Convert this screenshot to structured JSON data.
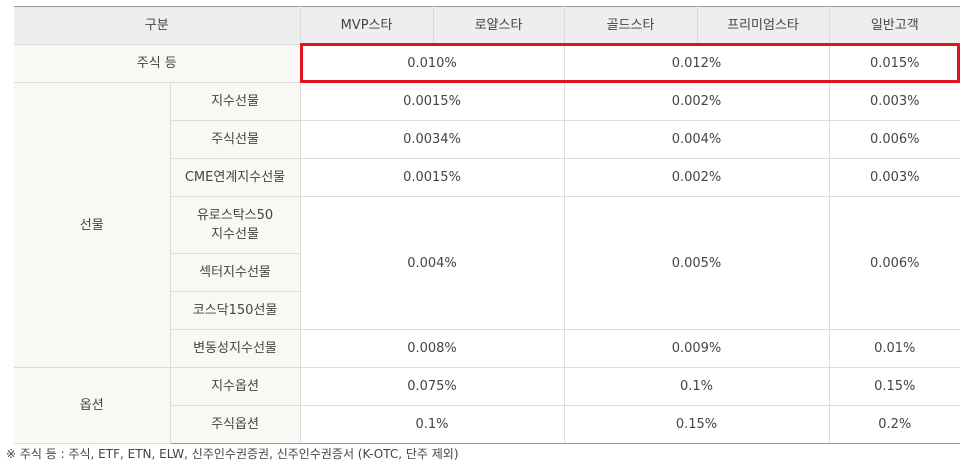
{
  "header": {
    "category": "구분",
    "tiers": [
      "MVP스타",
      "로얄스타",
      "골드스타",
      "프리미엄스타",
      "일반고객"
    ]
  },
  "stock": {
    "label": "주식 등",
    "values": [
      "0.010%",
      "0.012%",
      "0.015%"
    ]
  },
  "futures": {
    "group_label": "선물",
    "rows": [
      {
        "label": "지수선물",
        "values": [
          "0.0015%",
          "0.002%",
          "0.003%"
        ]
      },
      {
        "label": "주식선물",
        "values": [
          "0.0034%",
          "0.004%",
          "0.006%"
        ]
      },
      {
        "label": "CME연계지수선물",
        "values": [
          "0.0015%",
          "0.002%",
          "0.003%"
        ]
      },
      {
        "label_line1": "유로스탁스50",
        "label_line2": "지수선물"
      },
      {
        "label": "섹터지수선물"
      },
      {
        "label": "코스닥150선물"
      },
      {
        "label": "변동성지수선물",
        "values": [
          "0.008%",
          "0.009%",
          "0.01%"
        ]
      }
    ],
    "merged_values": [
      "0.004%",
      "0.005%",
      "0.006%"
    ]
  },
  "options": {
    "group_label": "옵션",
    "rows": [
      {
        "label": "지수옵션",
        "values": [
          "0.075%",
          "0.1%",
          "0.15%"
        ]
      },
      {
        "label": "주식옵션",
        "values": [
          "0.1%",
          "0.15%",
          "0.2%"
        ]
      }
    ]
  },
  "footnote": "※ 주식 등 : 주식, ETF, ETN, ELW, 신주인수권증권, 신주인수권증서 (K-OTC, 단주 제외)",
  "colors": {
    "highlight_border": "#e0141e",
    "header_bg": "#eeeeee",
    "category_bg": "#faf8f5"
  }
}
